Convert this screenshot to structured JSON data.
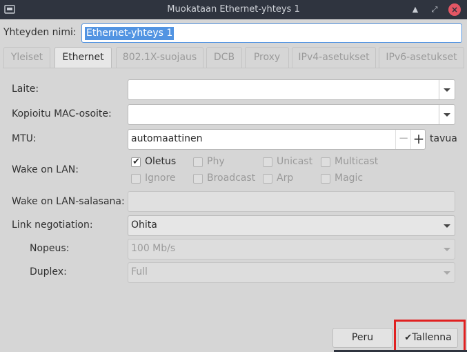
{
  "window": {
    "title": "Muokataan Ethernet-yhteys 1",
    "icons": [
      "network-icon",
      "maximize-icon",
      "restore-icon",
      "close-icon"
    ]
  },
  "connection_name": {
    "label": "Yhteyden nimi:",
    "value": "Ethernet-yhteys 1"
  },
  "tabs": [
    {
      "label": "Yleiset",
      "active": false
    },
    {
      "label": "Ethernet",
      "active": true
    },
    {
      "label": "802.1X-suojaus",
      "active": false
    },
    {
      "label": "DCB",
      "active": false
    },
    {
      "label": "Proxy",
      "active": false
    },
    {
      "label": "IPv4-asetukset",
      "active": false
    },
    {
      "label": "IPv6-asetukset",
      "active": false
    }
  ],
  "ethernet": {
    "device_label": "Laite:",
    "device_value": "",
    "cloned_mac_label": "Kopioitu MAC-osoite:",
    "cloned_mac_value": "",
    "mtu_label": "MTU:",
    "mtu_value": "automaattinen",
    "mtu_unit": "tavua",
    "wol_label": "Wake on LAN:",
    "wol_options": [
      {
        "label": "Oletus",
        "checked": true
      },
      {
        "label": "Phy",
        "checked": false
      },
      {
        "label": "Unicast",
        "checked": false
      },
      {
        "label": "Multicast",
        "checked": false
      },
      {
        "label": "Ignore",
        "checked": false
      },
      {
        "label": "Broadcast",
        "checked": false
      },
      {
        "label": "Arp",
        "checked": false
      },
      {
        "label": "Magic",
        "checked": false
      }
    ],
    "wol_password_label": "Wake on LAN-salasana:",
    "wol_password_value": "",
    "link_negotiation_label": "Link negotiation:",
    "link_negotiation_value": "Ohita",
    "speed_label": "Nopeus:",
    "speed_value": "100 Mb/s",
    "duplex_label": "Duplex:",
    "duplex_value": "Full"
  },
  "buttons": {
    "cancel": "Peru",
    "save": "Tallenna"
  },
  "colors": {
    "titlebar": "#2f343f",
    "accent": "#5294e2",
    "highlight": "#e02020",
    "close": "#e45664"
  }
}
